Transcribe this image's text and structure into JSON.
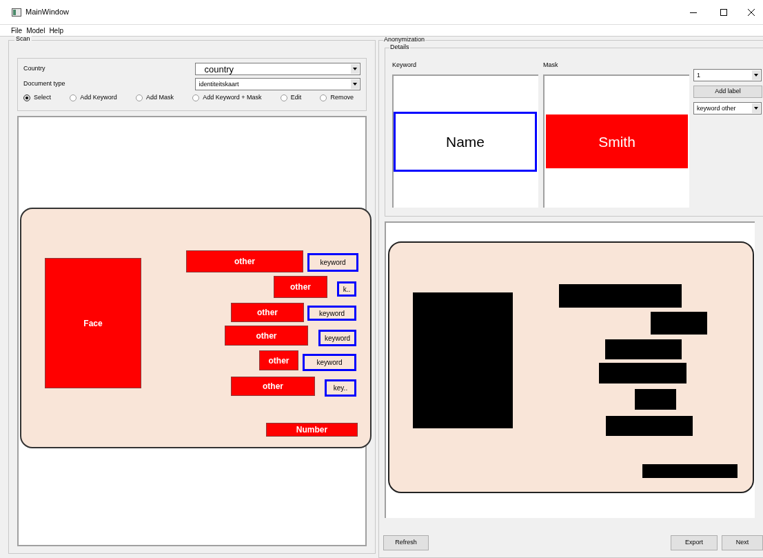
{
  "window": {
    "title": "MainWindow"
  },
  "menu": [
    "File",
    "Model",
    "Help"
  ],
  "scan": {
    "title": "Scan",
    "country": {
      "label": "Country",
      "value": "country"
    },
    "document_type": {
      "label": "Document type",
      "value": "identiteitskaart"
    },
    "modes": [
      {
        "label": "Select",
        "selected": true
      },
      {
        "label": "Add Keyword",
        "selected": false
      },
      {
        "label": "Add Mask",
        "selected": false
      },
      {
        "label": "Add Keyword + Mask",
        "selected": false
      },
      {
        "label": "Edit",
        "selected": false
      },
      {
        "label": "Remove",
        "selected": false
      }
    ],
    "regions": [
      {
        "kind": "mask",
        "label": "Face"
      },
      {
        "kind": "mask",
        "label": "other"
      },
      {
        "kind": "keyword",
        "label": "keyword"
      },
      {
        "kind": "mask",
        "label": "other"
      },
      {
        "kind": "keyword",
        "label": "k.."
      },
      {
        "kind": "mask",
        "label": "other"
      },
      {
        "kind": "keyword",
        "label": "keyword"
      },
      {
        "kind": "mask",
        "label": "other"
      },
      {
        "kind": "keyword",
        "label": "keyword"
      },
      {
        "kind": "mask",
        "label": "other"
      },
      {
        "kind": "keyword",
        "label": "keyword"
      },
      {
        "kind": "mask",
        "label": "other"
      },
      {
        "kind": "keyword",
        "label": "key.."
      },
      {
        "kind": "mask",
        "label": "Number"
      }
    ]
  },
  "anonymization": {
    "title": "Anonymization",
    "details": {
      "title": "Details",
      "keyword": {
        "label": "Keyword",
        "value": "Name"
      },
      "mask": {
        "label": "Mask",
        "value": "Smith"
      },
      "label_number": "1",
      "add_label": "Add label",
      "label_type": "keyword other"
    }
  },
  "buttons": {
    "refresh": "Refresh",
    "export": "Export",
    "next": "Next"
  }
}
